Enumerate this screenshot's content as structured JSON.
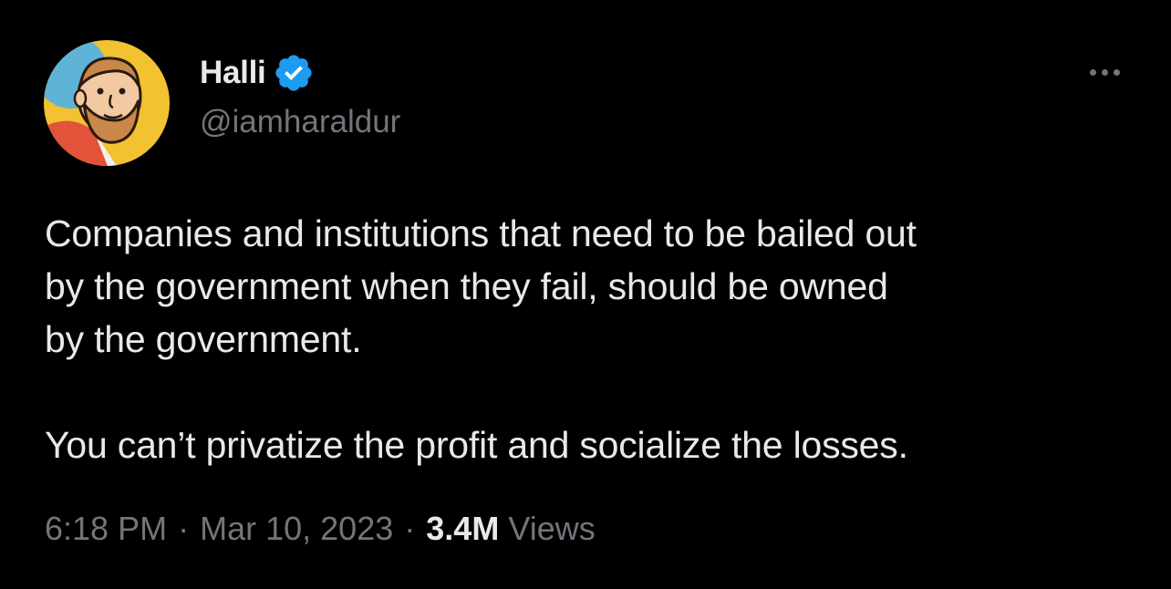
{
  "author": {
    "display_name": "Halli",
    "handle": "@iamharaldur",
    "verified": true,
    "avatar_icon": "cartoon-bearded-man-avatar"
  },
  "tweet": {
    "lines": [
      "Companies and institutions that need to be bailed out",
      "by the government when they fail, should be owned",
      "by the government."
    ],
    "second_paragraph": "You can’t privatize the profit and socialize the losses."
  },
  "meta": {
    "time": "6:18 PM",
    "separator": "·",
    "date": "Mar 10, 2023",
    "views_count": "3.4M",
    "views_label": "Views"
  },
  "icons": {
    "more": "more-options-icon",
    "verified": "verified-badge-icon"
  },
  "colors": {
    "background": "#000000",
    "text_primary": "#e7e9ea",
    "text_secondary": "#71767b",
    "verified_blue": "#1d9bf0"
  }
}
